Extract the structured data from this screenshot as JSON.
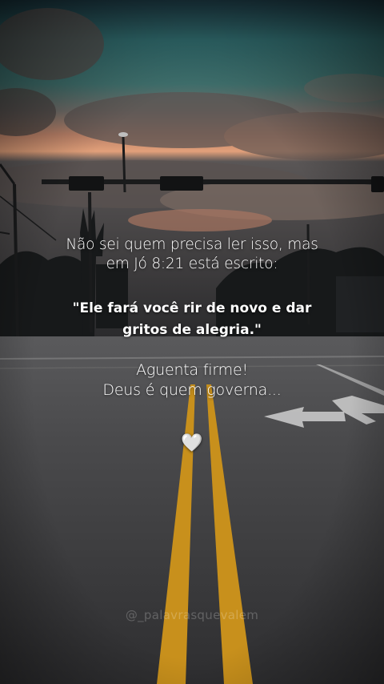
{
  "post": {
    "intro_lines": [
      "Não sei quem precisa ler isso, mas",
      "em Jó 8:21 está escrito:"
    ],
    "quote_lines": [
      "\"Ele fará você rir de novo e dar",
      "gritos de alegria.\""
    ],
    "encouragement_lines": [
      "Aguenta firme!",
      "Deus é quem governa..."
    ],
    "heart_icon": "heart-icon",
    "heart_glyph": "🤍",
    "watermark": "@_palavrasquevalem"
  },
  "colors": {
    "sky_top": "#1d3a3f",
    "sky_teal": "#2f6a6b",
    "horizon_glow": "#e08a5a",
    "road": "#3c3c3e",
    "road_center_lines": "#d29a1e",
    "text": "#ffffff"
  }
}
